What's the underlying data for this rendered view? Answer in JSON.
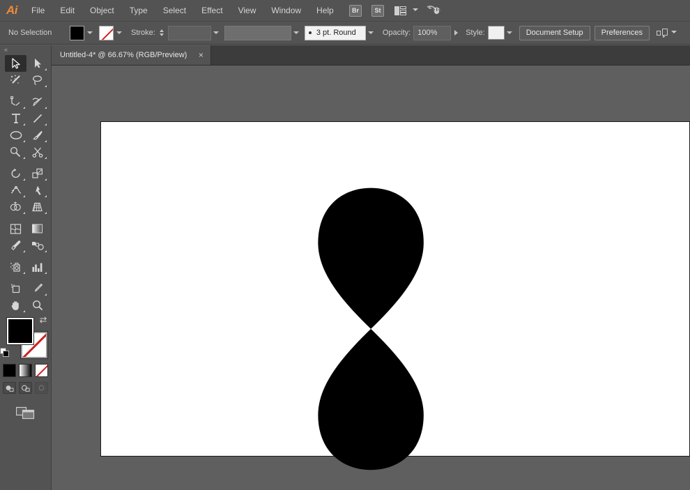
{
  "app": {
    "name": "Adobe Illustrator",
    "logo_text": "Ai"
  },
  "menubar": {
    "items": [
      {
        "label": "File"
      },
      {
        "label": "Edit"
      },
      {
        "label": "Object"
      },
      {
        "label": "Type"
      },
      {
        "label": "Select"
      },
      {
        "label": "Effect"
      },
      {
        "label": "View"
      },
      {
        "label": "Window"
      },
      {
        "label": "Help"
      }
    ],
    "right_icons": [
      {
        "name": "bridge-icon",
        "label": "Br"
      },
      {
        "name": "stock-icon",
        "label": "St"
      },
      {
        "name": "arrange-documents-icon",
        "label": ""
      },
      {
        "name": "search-adobe-icon",
        "label": ""
      }
    ]
  },
  "controlbar": {
    "selection_status": "No Selection",
    "fill_swatch_color": "#000000",
    "stroke_swatch": "none",
    "stroke_label": "Stroke:",
    "stroke_weight": "",
    "variable_width_profile": "",
    "brush_definition": "3 pt. Round",
    "opacity_label": "Opacity:",
    "opacity_value": "100%",
    "style_label": "Style:",
    "style_swatch_color": "#f0f0f0",
    "document_setup_label": "Document Setup",
    "preferences_label": "Preferences",
    "align_icon_name": "align-to-icon"
  },
  "tabbar": {
    "document_tab": {
      "title": "Untitled-4* @ 66.67% (RGB/Preview)",
      "close_label": "×"
    }
  },
  "toolpanel": {
    "collapse_label": "«",
    "tools": [
      {
        "name": "selection-tool",
        "label": "Selection Tool",
        "active": true
      },
      {
        "name": "direct-selection-tool",
        "label": "Direct Selection Tool",
        "active": false
      },
      {
        "name": "magic-wand-tool",
        "label": "Magic Wand Tool",
        "active": false
      },
      {
        "name": "lasso-tool",
        "label": "Lasso Tool",
        "active": false
      },
      {
        "name": "pen-tool",
        "label": "Pen Tool",
        "active": false
      },
      {
        "name": "curvature-tool",
        "label": "Curvature Tool",
        "active": false
      },
      {
        "name": "type-tool",
        "label": "Type Tool",
        "active": false
      },
      {
        "name": "line-segment-tool",
        "label": "Line Segment Tool",
        "active": false
      },
      {
        "name": "ellipse-tool",
        "label": "Ellipse Tool",
        "active": false
      },
      {
        "name": "paintbrush-tool",
        "label": "Paintbrush Tool",
        "active": false
      },
      {
        "name": "shaper-tool",
        "label": "Shaper Tool",
        "active": false
      },
      {
        "name": "scissors-tool",
        "label": "Scissors Tool",
        "active": false
      },
      {
        "name": "rotate-tool",
        "label": "Rotate Tool",
        "active": false
      },
      {
        "name": "scale-tool",
        "label": "Scale Tool",
        "active": false
      },
      {
        "name": "width-tool",
        "label": "Width Tool",
        "active": false
      },
      {
        "name": "free-transform-tool",
        "label": "Free Transform Tool",
        "active": false
      },
      {
        "name": "shape-builder-tool",
        "label": "Shape Builder Tool",
        "active": false
      },
      {
        "name": "perspective-grid-tool",
        "label": "Perspective Grid Tool",
        "active": false
      },
      {
        "name": "mesh-tool",
        "label": "Mesh Tool",
        "active": false
      },
      {
        "name": "gradient-tool",
        "label": "Gradient Tool",
        "active": false
      },
      {
        "name": "eyedropper-tool",
        "label": "Eyedropper Tool",
        "active": false
      },
      {
        "name": "blend-tool",
        "label": "Blend Tool",
        "active": false
      },
      {
        "name": "symbol-sprayer-tool",
        "label": "Symbol Sprayer Tool",
        "active": false
      },
      {
        "name": "column-graph-tool",
        "label": "Column Graph Tool",
        "active": false
      },
      {
        "name": "artboard-tool",
        "label": "Artboard Tool",
        "active": false
      },
      {
        "name": "slice-tool",
        "label": "Slice Tool",
        "active": false
      },
      {
        "name": "hand-tool",
        "label": "Hand Tool",
        "active": false
      },
      {
        "name": "zoom-tool",
        "label": "Zoom Tool",
        "active": false
      }
    ],
    "color_controls": {
      "fill_color": "#000000",
      "stroke_color": "none",
      "swap_label": "⇄",
      "fill_mode_color": "#000000",
      "fill_mode_gradient": "white-to-black",
      "fill_mode_none": "none"
    },
    "draw_modes": [
      {
        "name": "draw-normal-mode",
        "enabled": true
      },
      {
        "name": "draw-behind-mode",
        "enabled": true
      },
      {
        "name": "draw-inside-mode",
        "enabled": false
      }
    ],
    "screen_mode": {
      "name": "change-screen-mode-button"
    }
  },
  "canvas": {
    "background_color": "#5f5f5f",
    "artboard_color": "#ffffff",
    "zoom_level": "66.67%",
    "artwork": {
      "name": "hourglass-teardrop-shape",
      "fill_color": "#000000",
      "description": "Two teardrop shapes meeting point-to-point forming an hourglass"
    }
  }
}
